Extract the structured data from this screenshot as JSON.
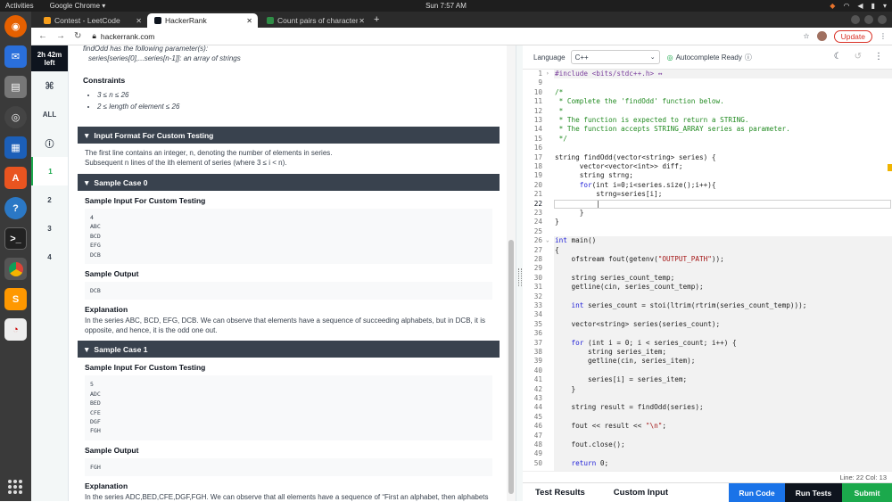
{
  "system": {
    "activities": "Activities",
    "app_menu": "Google Chrome ▾",
    "clock": "Sun  7:57 AM"
  },
  "browser": {
    "tabs": [
      {
        "label": "Contest - LeetCode",
        "active": false,
        "icon": "leetcode-icon"
      },
      {
        "label": "HackerRank",
        "active": true,
        "icon": "hackerrank-icon"
      },
      {
        "label": "Count pairs of characters",
        "active": false,
        "icon": "gfg-icon"
      }
    ],
    "url": "hackerrank.com",
    "update_label": "Update"
  },
  "sidebar": {
    "timer_line1": "2h 42m",
    "timer_line2": "left",
    "items": [
      {
        "label": "⌘",
        "selected": false
      },
      {
        "label": "ALL",
        "selected": false
      },
      {
        "label": "ⓘ",
        "selected": false
      },
      {
        "label": "1",
        "selected": true
      },
      {
        "label": "2",
        "selected": false
      },
      {
        "label": "3",
        "selected": false
      },
      {
        "label": "4",
        "selected": false
      }
    ]
  },
  "problem": {
    "params_intro": "findOdd has the following parameter(s):",
    "param": "series[series[0],...series[n-1]]:  an array of strings",
    "constraints_title": "Constraints",
    "constraints": [
      "3 ≤ n ≤ 26",
      "2 ≤ length of element ≤ 26"
    ],
    "input_format_title": "Input Format For Custom Testing",
    "input_format_line1": "The first line contains an integer, n, denoting the number of elements in series.",
    "input_format_line2": "Subsequent n lines of the ith element of series (where 3 ≤ i < n).",
    "sample0": {
      "title": "Sample Case 0",
      "input_label": "Sample Input For Custom Testing",
      "input": [
        "4",
        "ABC",
        "BCD",
        "EFG",
        "DCB"
      ],
      "output_label": "Sample Output",
      "output": "DCB",
      "explanation_label": "Explanation",
      "explanation": "In the series ABC, BCD, EFG, DCB. We can observe that elements have a sequence of succeeding alphabets, but in DCB, it is opposite, and hence, it is the odd one out."
    },
    "sample1": {
      "title": "Sample Case 1",
      "input_label": "Sample Input For Custom Testing",
      "input": [
        "5",
        "ADC",
        "BED",
        "CFE",
        "DGF",
        "FGH"
      ],
      "output_label": "Sample Output",
      "output": "FGH",
      "explanation_label": "Explanation",
      "explanation": "In the series ADC,BED,CFE,DGF,FGH. We can observe that all elements have a sequence of “First an alphabet, then alphabets after skipping two alphabets then alphabet after skipping one place” except FGH, and hence, it is the odd one out."
    }
  },
  "editor": {
    "language_label": "Language",
    "language_value": "C++",
    "autocomplete": "Autocomplete Ready",
    "status": "Line: 22  Col: 13",
    "bottom_tabs": [
      "Test Results",
      "Custom Input"
    ],
    "run_code": "Run Code",
    "run_tests": "Run Tests",
    "submit": "Submit",
    "colors": {
      "run_code": "#1a73e8",
      "run_tests": "#0e141e",
      "submit": "#1ba94c"
    },
    "lines": [
      {
        "n": "1",
        "fold": "›",
        "t": "#include <bits/stdc++.h>",
        "cls": "pp",
        "suffix": " ↔"
      },
      {
        "n": "9",
        "t": ""
      },
      {
        "n": "10",
        "t": "/*",
        "cls": "cmt"
      },
      {
        "n": "11",
        "t": " * Complete the 'findOdd' function below.",
        "cls": "cmt"
      },
      {
        "n": "12",
        "t": " *",
        "cls": "cmt"
      },
      {
        "n": "13",
        "t": " * The function is expected to return a STRING.",
        "cls": "cmt"
      },
      {
        "n": "14",
        "t": " * The function accepts STRING_ARRAY series as parameter.",
        "cls": "cmt"
      },
      {
        "n": "15",
        "t": " */",
        "cls": "cmt"
      },
      {
        "n": "16",
        "t": ""
      },
      {
        "n": "17",
        "t": "string findOdd(vector<string> series) {"
      },
      {
        "n": "18",
        "t": "      vector<vector<int>> diff;"
      },
      {
        "n": "19",
        "t": "      string strng;"
      },
      {
        "n": "20",
        "t": "      for(int i=0;i<series.size();i++){"
      },
      {
        "n": "21",
        "t": "          strng=series[i];"
      },
      {
        "n": "22",
        "t": "          |"
      },
      {
        "n": "23",
        "t": "      }"
      },
      {
        "n": "24",
        "t": "}"
      },
      {
        "n": "25",
        "t": ""
      },
      {
        "n": "26",
        "fold": "⌄",
        "t": "int main()"
      },
      {
        "n": "27",
        "t": "{"
      },
      {
        "n": "28",
        "t": "    ofstream fout(getenv(\"OUTPUT_PATH\"));"
      },
      {
        "n": "29",
        "t": ""
      },
      {
        "n": "30",
        "t": "    string series_count_temp;"
      },
      {
        "n": "31",
        "t": "    getline(cin, series_count_temp);"
      },
      {
        "n": "32",
        "t": ""
      },
      {
        "n": "33",
        "t": "    int series_count = stoi(ltrim(rtrim(series_count_temp)));"
      },
      {
        "n": "34",
        "t": ""
      },
      {
        "n": "35",
        "t": "    vector<string> series(series_count);"
      },
      {
        "n": "36",
        "t": ""
      },
      {
        "n": "37",
        "t": "    for (int i = 0; i < series_count; i++) {"
      },
      {
        "n": "38",
        "t": "        string series_item;"
      },
      {
        "n": "39",
        "t": "        getline(cin, series_item);"
      },
      {
        "n": "40",
        "t": ""
      },
      {
        "n": "41",
        "t": "        series[i] = series_item;"
      },
      {
        "n": "42",
        "t": "    }"
      },
      {
        "n": "43",
        "t": ""
      },
      {
        "n": "44",
        "t": "    string result = findOdd(series);"
      },
      {
        "n": "45",
        "t": ""
      },
      {
        "n": "46",
        "t": "    fout << result << \"\\n\";"
      },
      {
        "n": "47",
        "t": ""
      },
      {
        "n": "48",
        "t": "    fout.close();"
      },
      {
        "n": "49",
        "t": ""
      },
      {
        "n": "50",
        "t": "    return 0;"
      }
    ]
  }
}
